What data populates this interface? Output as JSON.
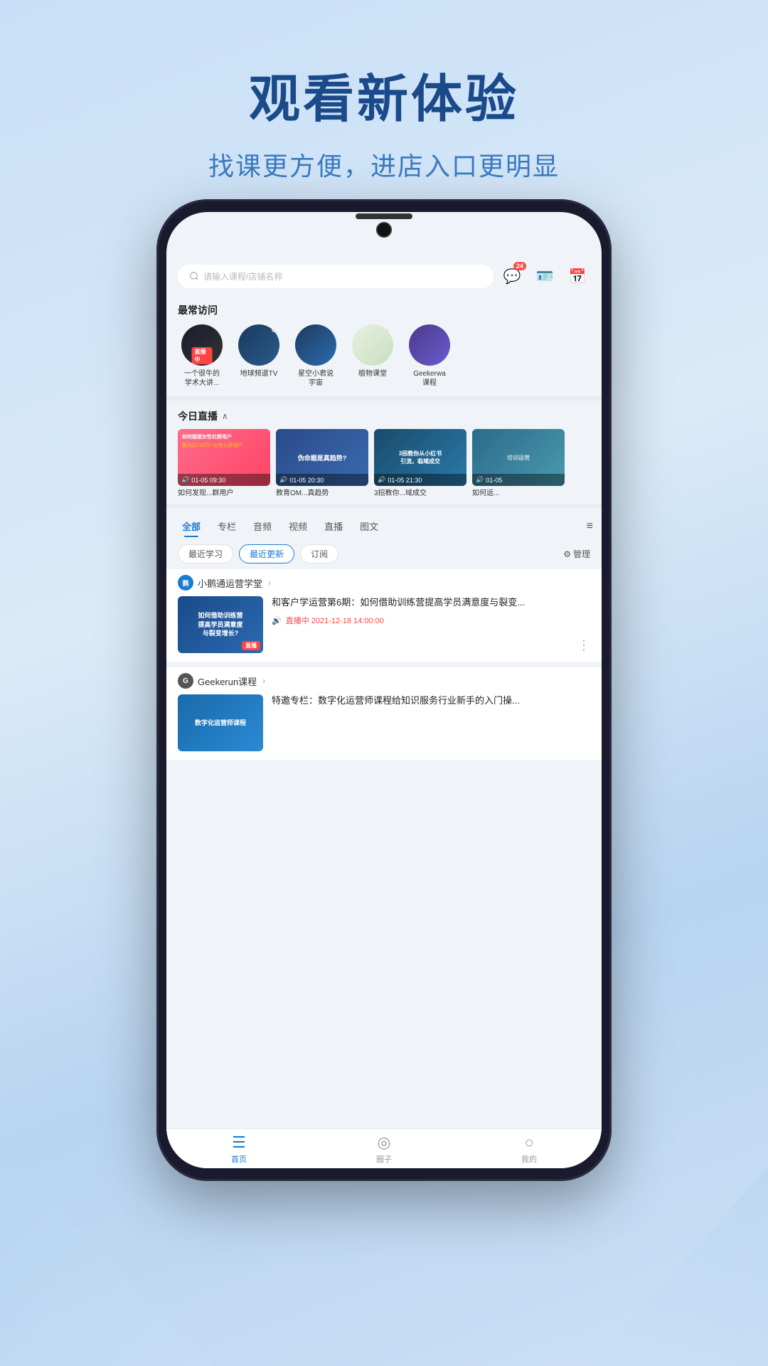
{
  "hero": {
    "title": "观看新体验",
    "subtitle": "找课更方便，进店入口更明显"
  },
  "search": {
    "placeholder": "请输入课程/店铺名称",
    "msg_badge": "24"
  },
  "most_visited": {
    "section_title": "最常访问",
    "channels": [
      {
        "name": "一个很牛的学术大讲...",
        "live": true,
        "dot": false
      },
      {
        "name": "地球频道TV",
        "live": false,
        "dot": true
      },
      {
        "name": "星空小君说宇宙",
        "live": false,
        "dot": false
      },
      {
        "name": "植物课堂",
        "live": false,
        "dot": true
      },
      {
        "name": "Geekerwa课程",
        "live": false,
        "dot": false
      }
    ]
  },
  "live_today": {
    "section_title": "今日直播",
    "cards": [
      {
        "time": "01-05 09:30",
        "title": "如何发现...群用户"
      },
      {
        "time": "01-05 20:30",
        "title": "教育OM...真趋势"
      },
      {
        "time": "01-05 21:30",
        "title": "3招教你...域成交"
      },
      {
        "time": "01-05",
        "title": "如何运..."
      }
    ]
  },
  "tabs": {
    "items": [
      "全部",
      "专栏",
      "音频",
      "视频",
      "直播",
      "图文"
    ],
    "active": "全部"
  },
  "filters": {
    "items": [
      "最近学习",
      "最近更新",
      "订阅"
    ],
    "active": "最近更新",
    "manage": "管理"
  },
  "shops": [
    {
      "name": "小鹅通运营学堂",
      "avatar_text": "鹅",
      "content": {
        "title": "和客户学运营第6期：如何借助训练营提高学员满意度与裂变...",
        "thumb_text": "如何借助训练营\n提高学员满意度\n与裂变增长?",
        "meta": "直播中 2021-12-18 14:00:00",
        "live": true
      }
    },
    {
      "name": "Geekerun课程",
      "avatar_text": "G",
      "content": {
        "title": "特邀专栏：数字化运营师课程给知识服务行业新手的入门操...",
        "thumb_text": "数字化运营师课程",
        "live": false
      }
    }
  ],
  "bottom_nav": {
    "items": [
      {
        "label": "首页",
        "active": true
      },
      {
        "label": "圈子",
        "active": false
      },
      {
        "label": "我的",
        "active": false
      }
    ]
  }
}
